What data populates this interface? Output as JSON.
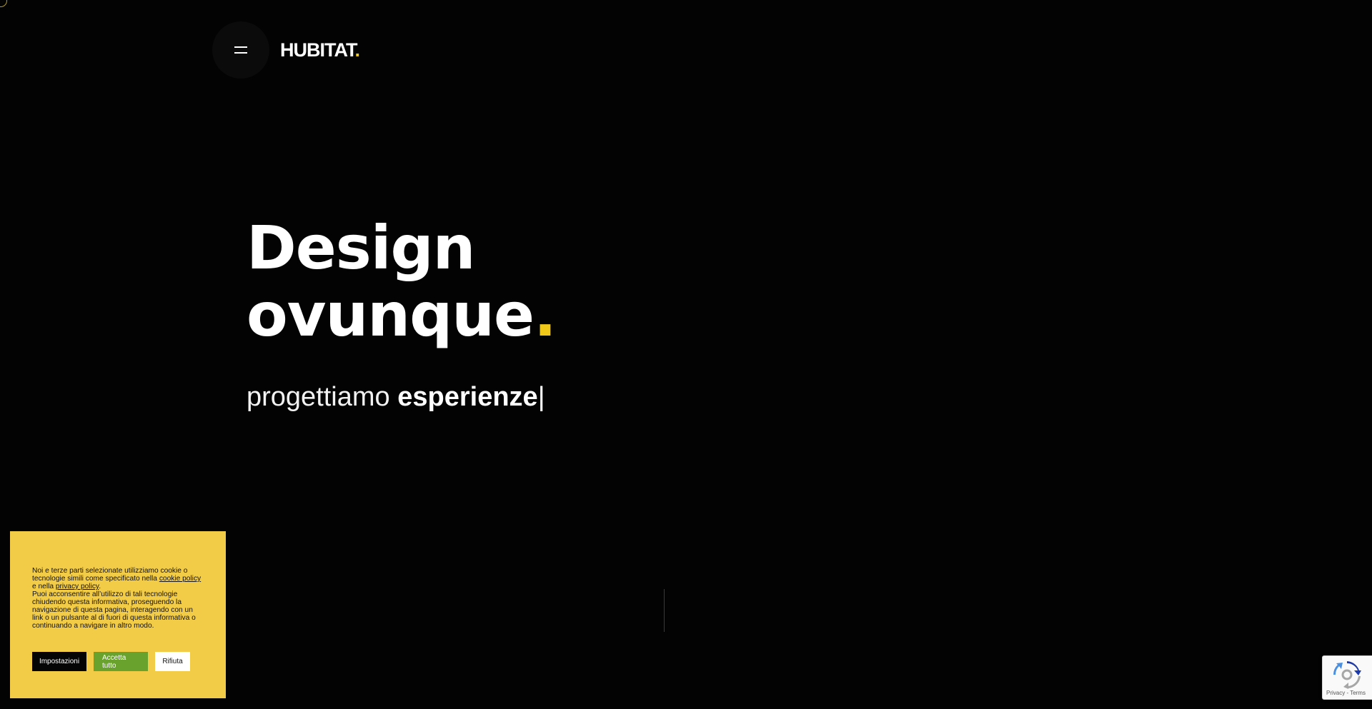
{
  "colors": {
    "background": "#030303",
    "accent_yellow": "#f0c919",
    "cookie_bg": "#f3cc47",
    "accept_green": "#6aa22e"
  },
  "header": {
    "menu_icon": "hamburger-menu-icon",
    "logo_text": "HUBITAT",
    "logo_dot": "."
  },
  "hero": {
    "line1": "Design",
    "line2": "ovunque",
    "line2_dot": ".",
    "sub_light": "progettiamo",
    "sub_strong": "esperienze",
    "sub_caret": "|"
  },
  "cookie_banner": {
    "text_1": "Noi e terze parti selezionate utilizziamo cookie o tecnologie simili come specificato nella",
    "cookie_policy_link": "cookie policy",
    "text_2": "e nella",
    "privacy_policy_link": "privacy policy",
    "text_3": ".",
    "text_4": "Puoi acconsentire all’utilizzo di tali tecnologie chiudendo questa informativa, proseguendo la navigazione di questa pagina, interagendo con un link o un pulsante al di fuori di questa informativa o continuando a navigare in altro modo.",
    "settings_button": "Impostazioni",
    "accept_button": "Accetta tutto",
    "reject_button": "Rifiuta"
  },
  "recaptcha": {
    "icon": "recaptcha-icon",
    "links": "Privacy - Terms"
  }
}
